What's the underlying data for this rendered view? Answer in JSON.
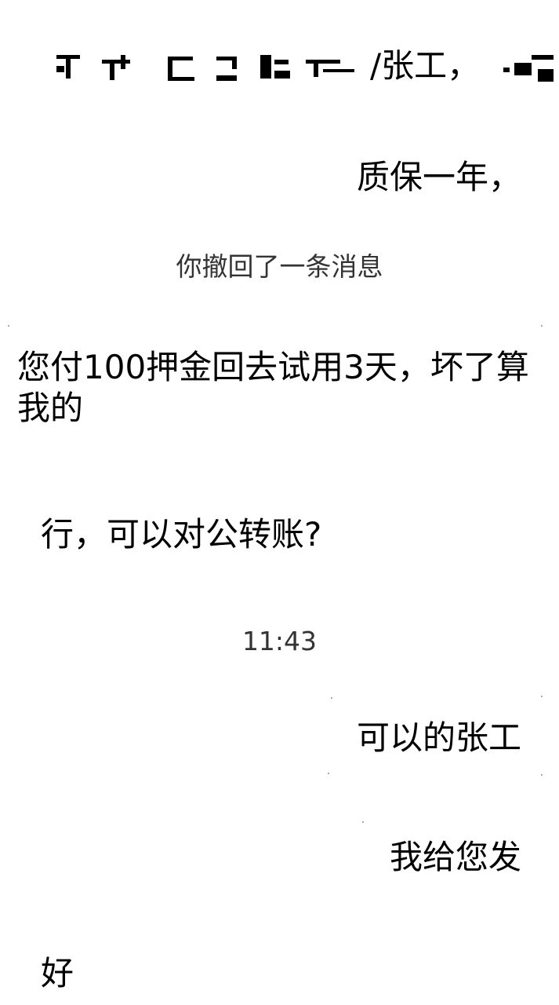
{
  "header": {
    "contact_name_suffix": "/张工，"
  },
  "messages": [
    {
      "side": "right",
      "text": "质保一年，"
    },
    {
      "side": "system",
      "text": "你撤回了一条消息"
    },
    {
      "side": "left",
      "text": "您付100押金回去试用3天，坏了算我的"
    },
    {
      "side": "left",
      "text": "行，可以对公转账?"
    },
    {
      "side": "system",
      "text": "11:43"
    },
    {
      "side": "right",
      "text": "可以的张工"
    },
    {
      "side": "right",
      "text": "我给您发"
    },
    {
      "side": "left",
      "text": "好"
    }
  ]
}
